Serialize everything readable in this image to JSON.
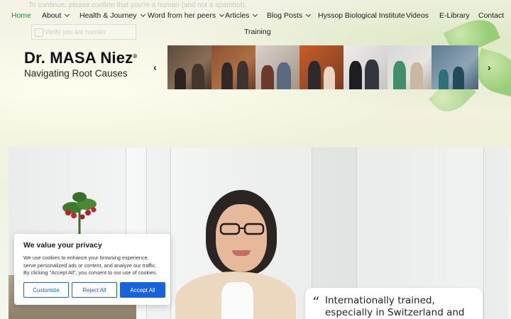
{
  "spam_check": {
    "notice": "To continue, please confirm that you're a human (and not a spambot).",
    "checkbox_label": "Verify you are human"
  },
  "nav": {
    "row1": [
      {
        "label": "Home",
        "active": true,
        "dropdown": false
      },
      {
        "label": "About",
        "dropdown": true
      },
      {
        "label": "Health & Journey",
        "dropdown": true
      },
      {
        "label": "Word from her peers",
        "dropdown": true
      },
      {
        "label": "Articles",
        "dropdown": true
      },
      {
        "label": "Blog Posts",
        "dropdown": true
      },
      {
        "label": "Hyssop Biological Institute",
        "dropdown": false
      },
      {
        "label": "Videos",
        "dropdown": false
      },
      {
        "label": "E-Library",
        "dropdown": false
      },
      {
        "label": "Contact",
        "dropdown": false
      }
    ],
    "row2": [
      {
        "label": "Training",
        "dropdown": false
      }
    ],
    "active_color": "#2a8a2f"
  },
  "logo": {
    "name": "Dr. MASA Niez",
    "registered_mark": "®",
    "tagline": "Navigating Root Causes"
  },
  "carousel": {
    "prev_icon": "chevron-left-icon",
    "next_icon": "chevron-right-icon",
    "prev_glyph": "‹",
    "next_glyph": "›",
    "slide_count": 7
  },
  "hero": {
    "quote_mark": "“",
    "quote_text": "Internationally trained, especially in Switzerland and Germany, in Biological"
  },
  "cookie_banner": {
    "title": "We value your privacy",
    "body": "We use cookies to enhance your browsing experience, serve personalized ads or content, and analyze our traffic. By clicking \"Accept All\", you consent to our use of cookies.",
    "customize_label": "Customize",
    "reject_label": "Reject All",
    "accept_label": "Accept All",
    "accent_color": "#1863dc"
  }
}
